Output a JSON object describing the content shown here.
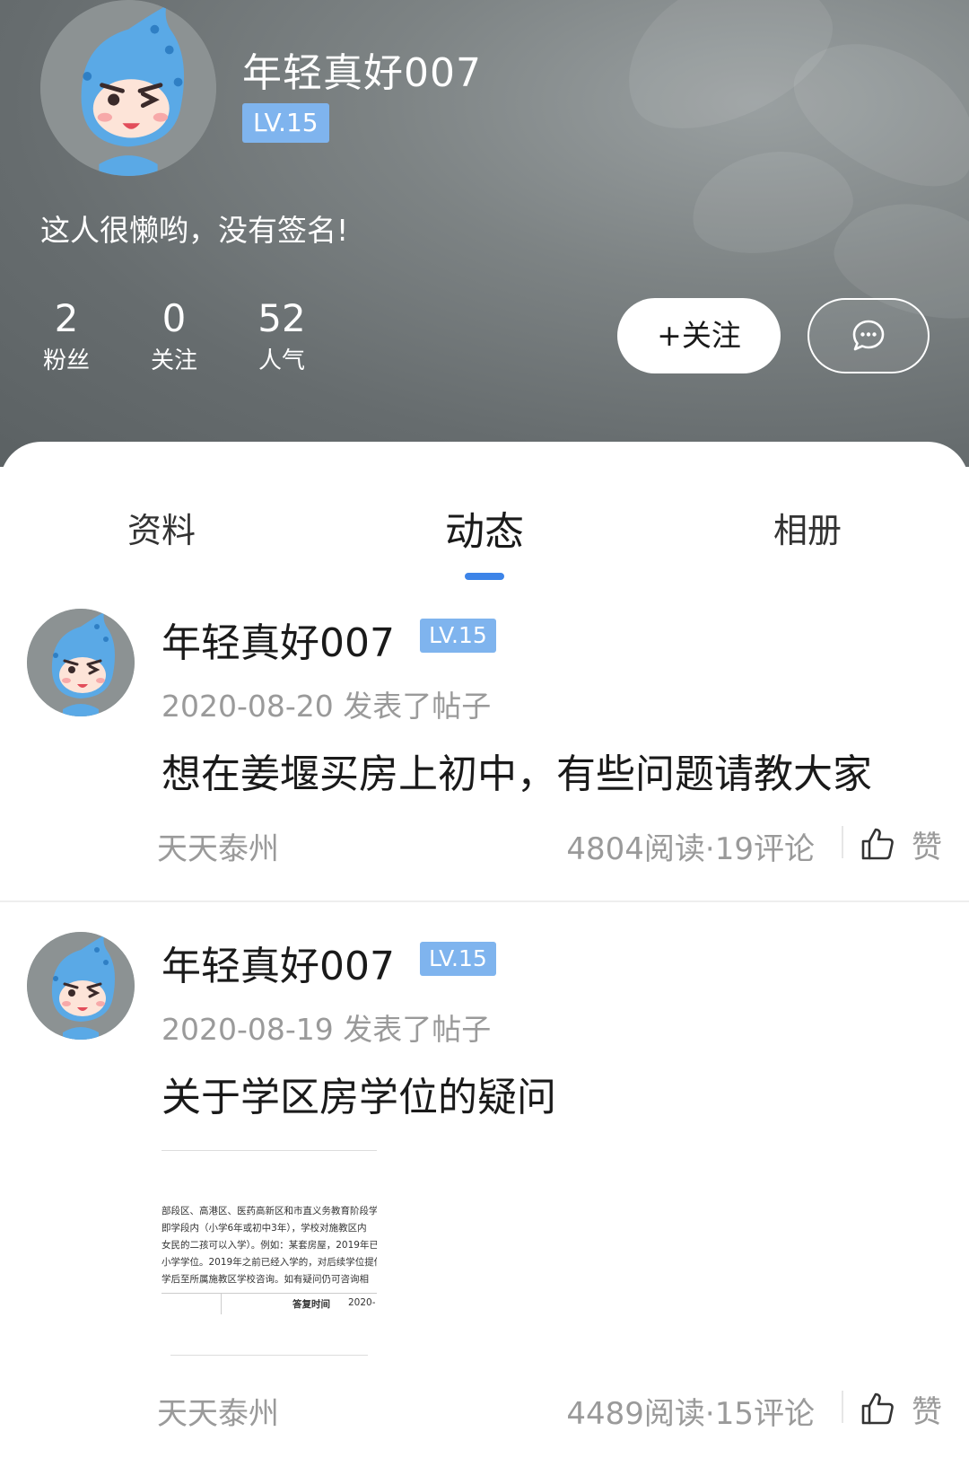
{
  "profile": {
    "username": "年轻真好007",
    "level": "LV.15",
    "bio": "这人很懒哟，没有签名!",
    "stats": [
      {
        "value": "2",
        "label": "粉丝"
      },
      {
        "value": "0",
        "label": "关注"
      },
      {
        "value": "52",
        "label": "人气"
      }
    ],
    "follow_label": "+关注",
    "message_icon": "chat-bubble-icon"
  },
  "tabs": [
    {
      "label": "资料",
      "active": false
    },
    {
      "label": "动态",
      "active": true
    },
    {
      "label": "相册",
      "active": false
    }
  ],
  "posts": [
    {
      "author": "年轻真好007",
      "level": "LV.15",
      "date": "2020-08-20",
      "action": "发表了帖子",
      "title": "想在姜堰买房上初中，有些问题请教大家",
      "source": "天天泰州",
      "stats": "4804阅读·19评论",
      "like_label": "赞"
    },
    {
      "author": "年轻真好007",
      "level": "LV.15",
      "date": "2020-08-19",
      "action": "发表了帖子",
      "title": "关于学区房学位的疑问",
      "source": "天天泰州",
      "stats": "4489阅读·15评论",
      "like_label": "赞",
      "thumbnail_lines": [
        "部段区、高港区、医药高新区和市直义务教育阶段学",
        "即学段内（小学6年或初中3年），学校对施教区内",
        "女民的二孩可以入学）。例如：某套房屋，2019年已",
        "小学学位。2019年之前已经入学的，对后续学位提供",
        "学后至所属施教区学校咨询。如有疑问仍可咨询相",
        "答复时间",
        "2020-"
      ]
    }
  ],
  "colors": {
    "accent": "#3d84e8",
    "badge": "#7fb4ee",
    "header_bg": "#6e7475"
  }
}
